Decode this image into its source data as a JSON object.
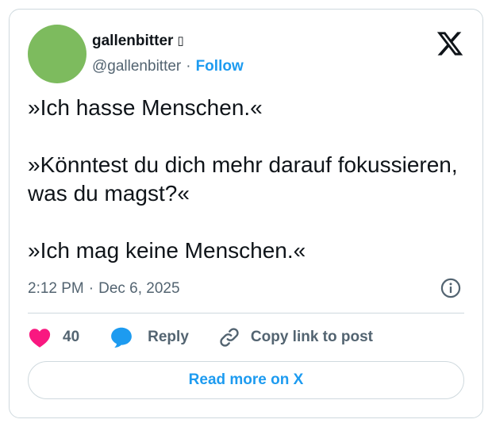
{
  "author": {
    "display_name": "gallenbitter",
    "badge_glyph": "▯",
    "handle": "@gallenbitter",
    "follow_label": "Follow",
    "avatar_color": "#7dbb5e"
  },
  "tweet": {
    "paragraphs": [
      "»Ich hasse Menschen.«",
      "»Könntest du dich mehr darauf fokussieren, was du magst?«",
      "»Ich mag keine Menschen.«"
    ],
    "time": "2:12 PM",
    "date": "Dec 6, 2025"
  },
  "actions": {
    "like_count": "40",
    "reply_label": "Reply",
    "copy_label": "Copy link to post"
  },
  "footer": {
    "read_more_label": "Read more on X"
  },
  "colors": {
    "accent": "#1d9bf0",
    "like": "#f91880",
    "text": "#0f1419",
    "muted": "#536471",
    "border": "#cfd9de"
  },
  "icons": {
    "brand": "x-logo-icon",
    "info": "info-icon",
    "like": "heart-icon",
    "reply": "speech-bubble-icon",
    "copy": "link-icon"
  }
}
